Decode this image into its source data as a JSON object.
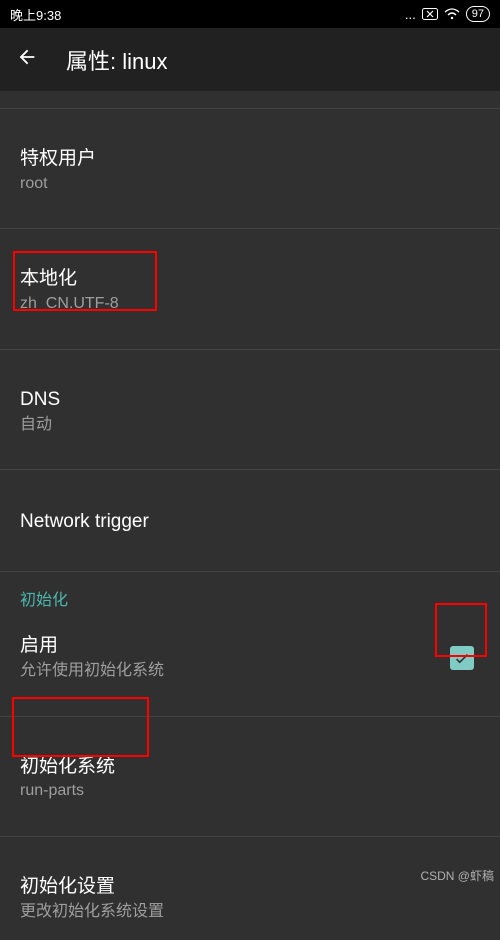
{
  "status": {
    "time": "晚上9:38",
    "battery": "97",
    "dots": "..."
  },
  "header": {
    "title": "属性: linux"
  },
  "settings": {
    "privileged": {
      "title": "特权用户",
      "value": "root"
    },
    "locale": {
      "title": "本地化",
      "value": "zh_CN.UTF-8"
    },
    "dns": {
      "title": "DNS",
      "value": "自动"
    },
    "network_trigger": {
      "title": "Network trigger"
    }
  },
  "init": {
    "section": "初始化",
    "enable": {
      "title": "启用",
      "sub": "允许使用初始化系统",
      "checked": true
    },
    "system": {
      "title": "初始化系统",
      "value": "run-parts"
    },
    "settings": {
      "title": "初始化设置",
      "sub": "更改初始化系统设置"
    }
  },
  "watermark": "CSDN @虾稿"
}
